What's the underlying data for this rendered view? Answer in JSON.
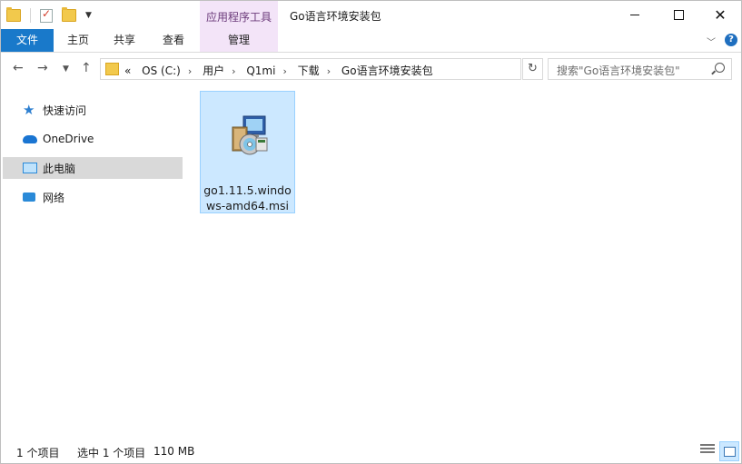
{
  "window": {
    "title": "Go语言环境安装包",
    "context_tab_group": "应用程序工具"
  },
  "ribbon": {
    "tabs": [
      {
        "label": "文件"
      },
      {
        "label": "主页"
      },
      {
        "label": "共享"
      },
      {
        "label": "查看"
      },
      {
        "label": "管理"
      }
    ]
  },
  "address": {
    "overflow": "«",
    "crumbs": [
      "OS (C:)",
      "用户",
      "Q1mi",
      "下载",
      "Go语言环境安装包"
    ]
  },
  "search": {
    "placeholder": "搜索\"Go语言环境安装包\""
  },
  "navpane": {
    "items": [
      {
        "label": "快速访问",
        "icon": "star-icon"
      },
      {
        "label": "OneDrive",
        "icon": "onedrive-cloud-icon"
      },
      {
        "label": "此电脑",
        "icon": "computer-icon",
        "selected": true
      },
      {
        "label": "网络",
        "icon": "network-icon"
      }
    ]
  },
  "files": [
    {
      "name": "go1.11.5.windows-amd64.msi",
      "icon": "msi-installer-icon",
      "selected": true
    }
  ],
  "status": {
    "count": "1 个项目",
    "selected": "选中 1 个项目",
    "size": "110 MB"
  },
  "colors": {
    "file_tab": "#1979ca",
    "context_tab": "#f3e4f8",
    "selection": "#cce8ff",
    "selection_border": "#99d1ff"
  }
}
